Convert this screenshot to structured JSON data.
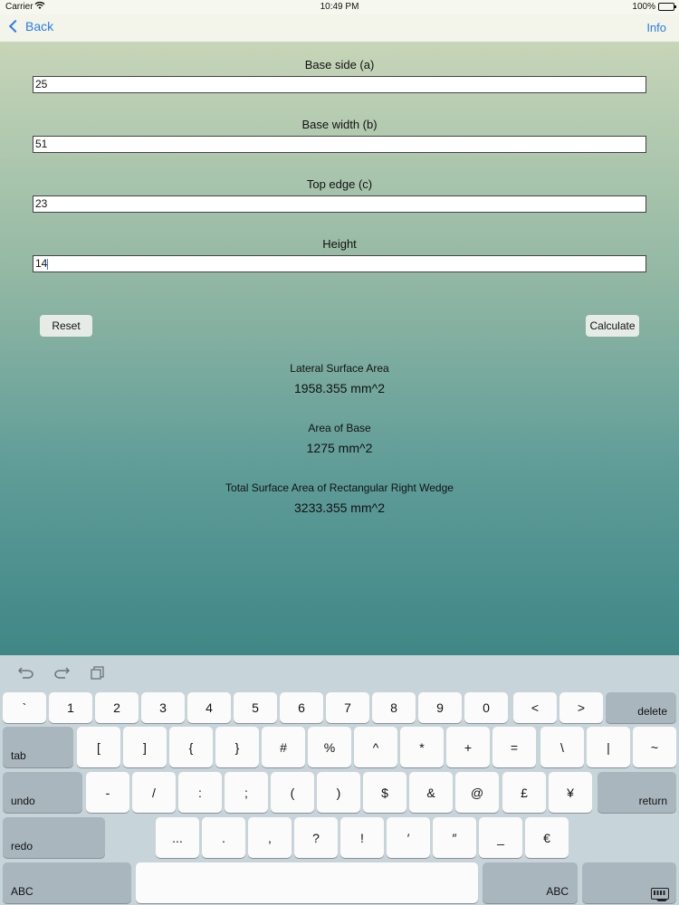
{
  "status_bar": {
    "carrier": "Carrier",
    "time": "10:49 PM",
    "battery": "100%"
  },
  "nav": {
    "back_label": "Back",
    "info_label": "Info"
  },
  "fields": [
    {
      "label": "Base side (a)",
      "value": "25"
    },
    {
      "label": "Base width (b)",
      "value": "51"
    },
    {
      "label": "Top edge (c)",
      "value": "23"
    },
    {
      "label": "Height",
      "value": "14"
    }
  ],
  "buttons": {
    "reset": "Reset",
    "calculate": "Calculate"
  },
  "results": [
    {
      "label": "Lateral Surface Area",
      "value": "1958.355 mm^2"
    },
    {
      "label": "Area of Base",
      "value": "1275 mm^2"
    },
    {
      "label": "Total Surface Area of Rectangular Right Wedge",
      "value": "3233.355 mm^2"
    }
  ],
  "keyboard": {
    "toolbar": [
      "undo-arrow-icon",
      "redo-arrow-icon",
      "paste-icon"
    ],
    "row1": [
      "`",
      "1",
      "2",
      "3",
      "4",
      "5",
      "6",
      "7",
      "8",
      "9",
      "0",
      "<",
      ">"
    ],
    "row1_delete": "delete",
    "row2_tab": "tab",
    "row2": [
      "[",
      "]",
      "{",
      "}",
      "#",
      "%",
      "^",
      "*",
      "+",
      "=",
      "\\",
      "|",
      "~"
    ],
    "row3_undo": "undo",
    "row3": [
      "-",
      "/",
      ":",
      ";",
      "(",
      ")",
      "$",
      "&",
      "@",
      "£",
      "¥"
    ],
    "row3_return": "return",
    "row4_redo": "redo",
    "row4": [
      "...",
      ".",
      ",",
      "?",
      "!",
      "′",
      "″",
      "_",
      "€"
    ],
    "row5_abc_left": "ABC",
    "row5_abc_right": "ABC"
  }
}
